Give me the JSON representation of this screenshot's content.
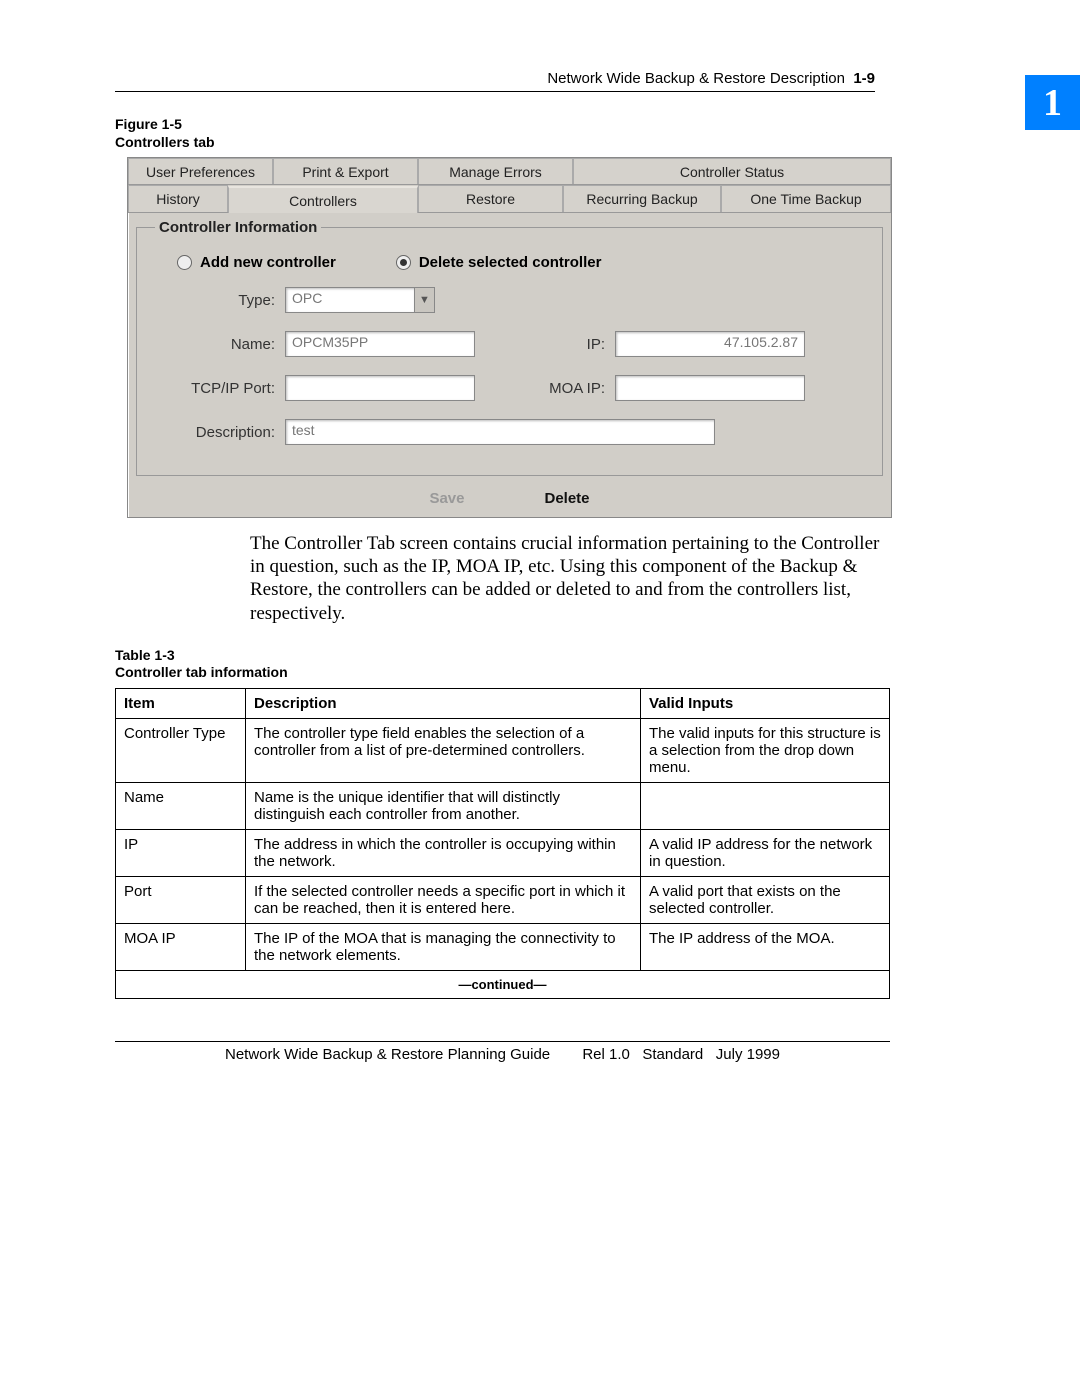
{
  "header": {
    "title": "Network Wide Backup & Restore Description",
    "page": "1-9"
  },
  "chapter": "1",
  "figure": {
    "number": "Figure 1-5",
    "title": "Controllers tab"
  },
  "screenshot": {
    "tabs_row1": [
      "User Preferences",
      "Print & Export",
      "Manage Errors",
      "Controller Status"
    ],
    "tabs_row2": [
      "History",
      "Controllers",
      "Restore",
      "Recurring Backup",
      "One Time Backup"
    ],
    "active_tab": "Controllers",
    "fieldset_legend": "Controller Information",
    "radios": {
      "add": "Add new controller",
      "del": "Delete selected controller"
    },
    "labels": {
      "type": "Type:",
      "name": "Name:",
      "ip": "IP:",
      "port": "TCP/IP Port:",
      "moa": "MOA IP:",
      "desc": "Description:"
    },
    "values": {
      "type": "OPC",
      "name": "OPCM35PP",
      "ip": "47.105.2.87",
      "port": "",
      "moa": "",
      "desc": "test"
    },
    "buttons": {
      "save": "Save",
      "delete": "Delete"
    }
  },
  "body_para": "The Controller Tab screen contains crucial information pertaining to the Controller in question, such as the IP, MOA IP, etc. Using this component of the Backup & Restore, the controllers can be added or deleted to and from the controllers list, respectively.",
  "table": {
    "number": "Table 1-3",
    "title": "Controller tab information",
    "headers": [
      "Item",
      "Description",
      "Valid Inputs"
    ],
    "rows": [
      [
        "Controller Type",
        "The controller type field enables the selection of a controller from a list of pre-determined controllers.",
        "The valid inputs for this structure is a selection from the drop down menu."
      ],
      [
        "Name",
        "Name is the unique identifier that will distinctly distinguish each controller from another.",
        ""
      ],
      [
        "IP",
        "The address in which the controller is occupying within the network.",
        "A valid IP address for the network in question."
      ],
      [
        "Port",
        "If the selected controller needs a specific port in which it can be reached, then it is entered here.",
        "A valid port that exists on the selected controller."
      ],
      [
        "MOA IP",
        "The IP of the MOA that is managing the connectivity to the network elements.",
        "The IP address of the MOA."
      ]
    ],
    "continued": "—continued—"
  },
  "footer": {
    "title": "Network Wide Backup & Restore Planning Guide",
    "rel": "Rel 1.0",
    "std": "Standard",
    "date": "July 1999"
  }
}
